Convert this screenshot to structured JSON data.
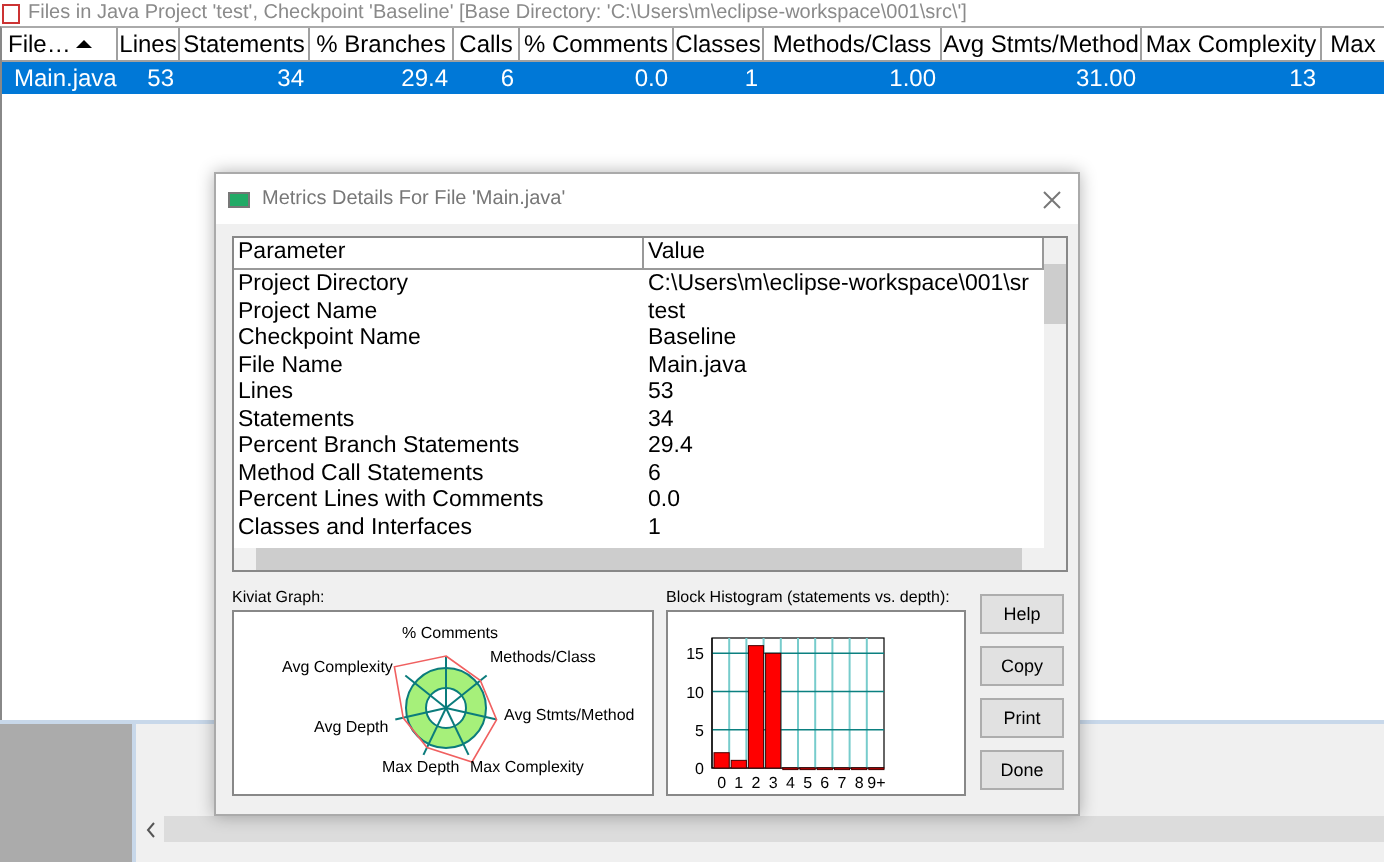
{
  "main_window": {
    "title": "Files in Java Project 'test', Checkpoint 'Baseline'  [Base Directory: 'C:\\Users\\m\\eclipse-workspace\\001\\src\\']",
    "columns": [
      {
        "label": "File…",
        "sorted": true
      },
      {
        "label": "Lines",
        "sorted": false
      },
      {
        "label": "Statements",
        "sorted": false
      },
      {
        "label": "% Branches",
        "sorted": false
      },
      {
        "label": "Calls",
        "sorted": false
      },
      {
        "label": "% Comments",
        "sorted": false
      },
      {
        "label": "Classes",
        "sorted": false
      },
      {
        "label": "Methods/Class",
        "sorted": false
      },
      {
        "label": "Avg Stmts/Method",
        "sorted": false
      },
      {
        "label": "Max Complexity",
        "sorted": false
      },
      {
        "label": "Max",
        "sorted": false
      }
    ],
    "rows": [
      {
        "selected": true,
        "cells": [
          "Main.java",
          "53",
          "34",
          "29.4",
          "6",
          "0.0",
          "1",
          "1.00",
          "31.00",
          "13"
        ]
      }
    ]
  },
  "dialog": {
    "title": "Metrics Details For File 'Main.java'",
    "table": {
      "columns": [
        "Parameter",
        "Value"
      ],
      "rows": [
        [
          "Project Directory",
          "C:\\Users\\m\\eclipse-workspace\\001\\sr"
        ],
        [
          "Project Name",
          "test"
        ],
        [
          "Checkpoint Name",
          "Baseline"
        ],
        [
          "File Name",
          "Main.java"
        ],
        [
          "Lines",
          "53"
        ],
        [
          "Statements",
          "34"
        ],
        [
          "Percent Branch Statements",
          "29.4"
        ],
        [
          "Method Call Statements",
          "6"
        ],
        [
          "Percent Lines with Comments",
          "0.0"
        ],
        [
          "Classes and Interfaces",
          "1"
        ]
      ]
    },
    "kiviat": {
      "label": "Kiviat Graph:",
      "axes": [
        "% Comments",
        "Methods/Class",
        "Avg Complexity",
        "Avg Stmts/Method",
        "Avg Depth",
        "Max Depth",
        "Max Complexity"
      ]
    },
    "histogram": {
      "label": "Block Histogram (statements vs. depth):",
      "chart_data": {
        "type": "bar",
        "categories": [
          "0",
          "1",
          "2",
          "3",
          "4",
          "5",
          "6",
          "7",
          "8",
          "9+"
        ],
        "values": [
          2,
          1,
          16,
          15,
          0,
          0,
          0,
          0,
          0,
          0
        ],
        "ylim": [
          0,
          17
        ],
        "yticks": [
          0,
          5,
          10,
          15
        ],
        "grid": true
      }
    },
    "buttons": [
      "Help",
      "Copy",
      "Print",
      "Done"
    ]
  }
}
